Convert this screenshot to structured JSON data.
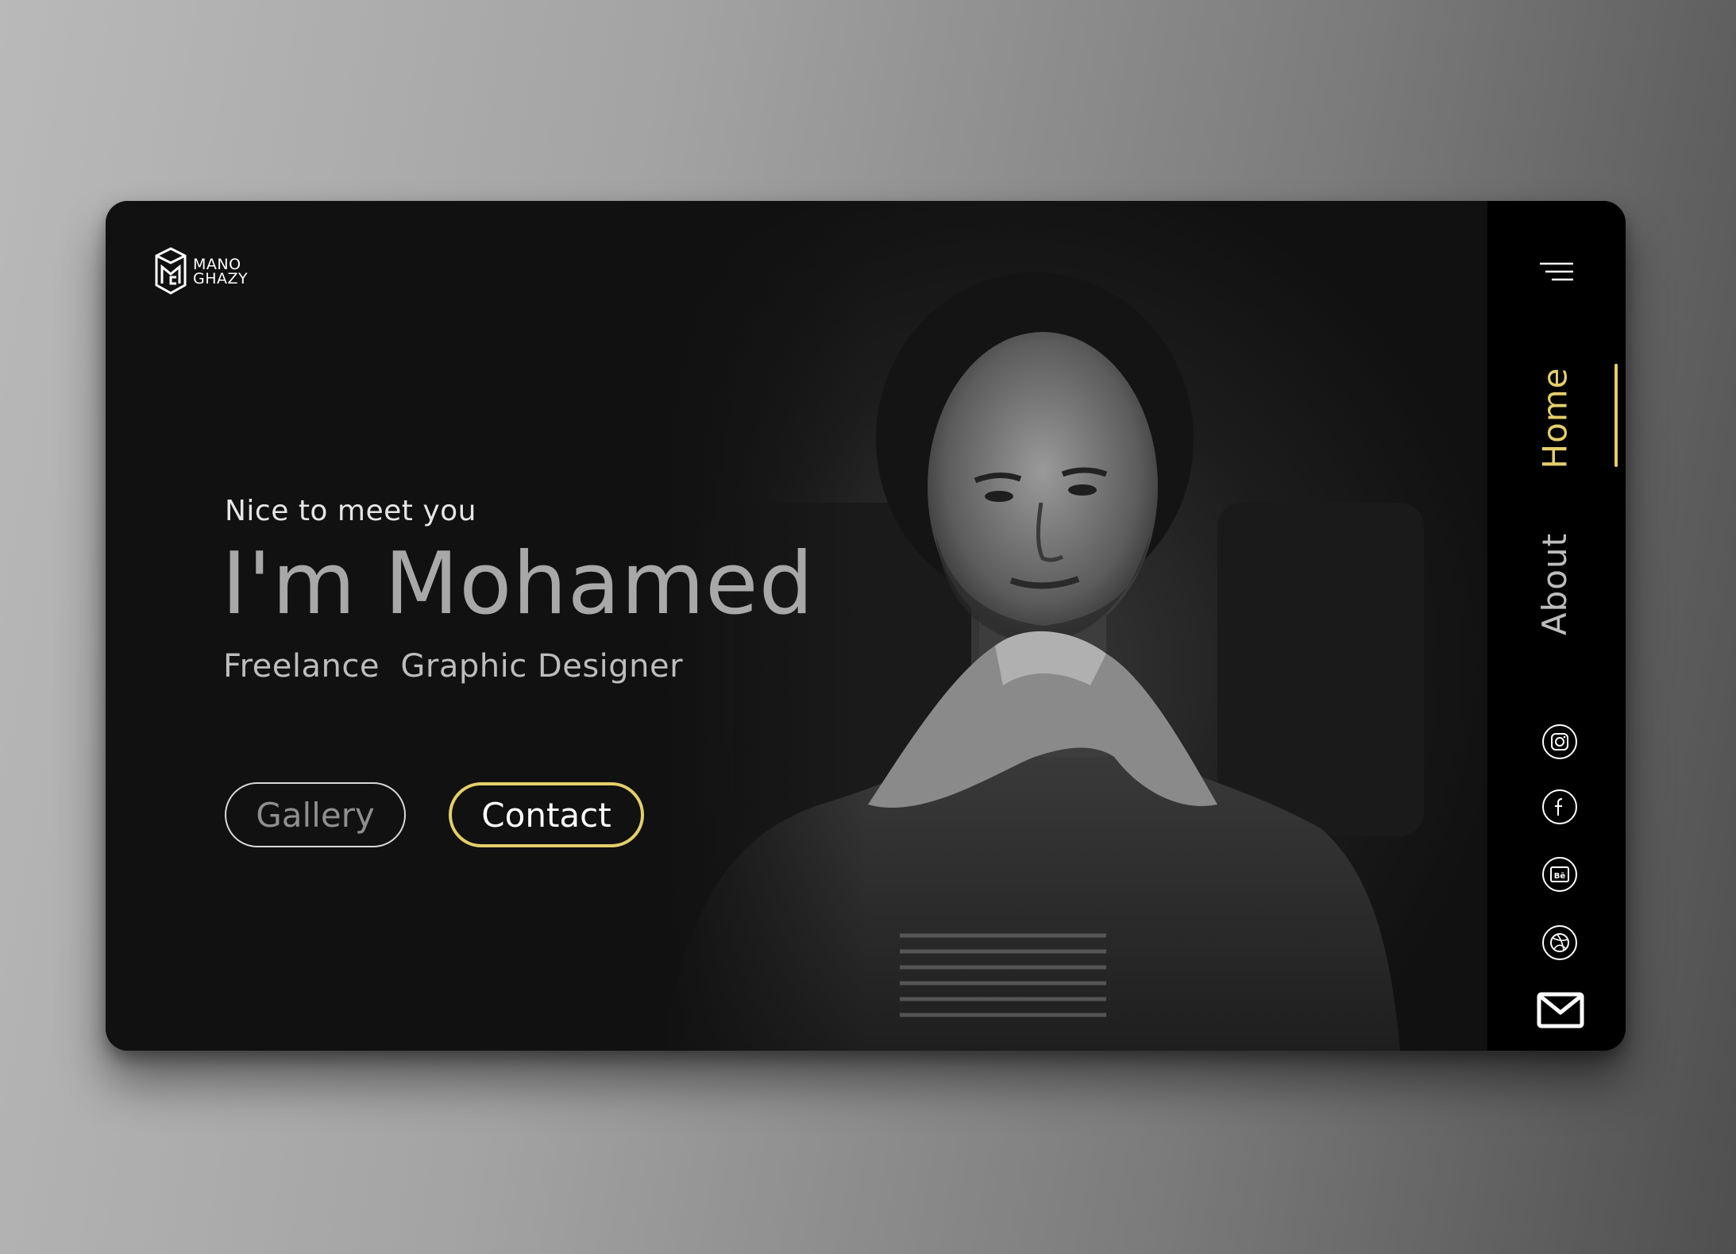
{
  "brand": {
    "line1": "MANO",
    "line2": "GHAZY",
    "logo_icon": "mg-monogram-logo"
  },
  "hero": {
    "greeting": "Nice to meet you",
    "name": "I'm Mohamed",
    "role": "Freelance  Graphic Designer",
    "photo": "portrait-photo"
  },
  "actions": {
    "gallery_label": "Gallery",
    "contact_label": "Contact"
  },
  "sidebar": {
    "menu_icon": "hamburger-menu-icon",
    "nav": [
      {
        "label": "Home",
        "active": true
      },
      {
        "label": "About",
        "active": false
      }
    ],
    "social": [
      {
        "icon": "instagram-icon"
      },
      {
        "icon": "facebook-icon"
      },
      {
        "icon": "behance-icon"
      },
      {
        "icon": "dribbble-icon"
      }
    ],
    "mail_icon": "mail-icon"
  },
  "colors": {
    "accent": "#e4cf6a",
    "card_bg": "#111111",
    "sidebar_bg": "#000000",
    "text_muted": "#a8a8a8"
  }
}
